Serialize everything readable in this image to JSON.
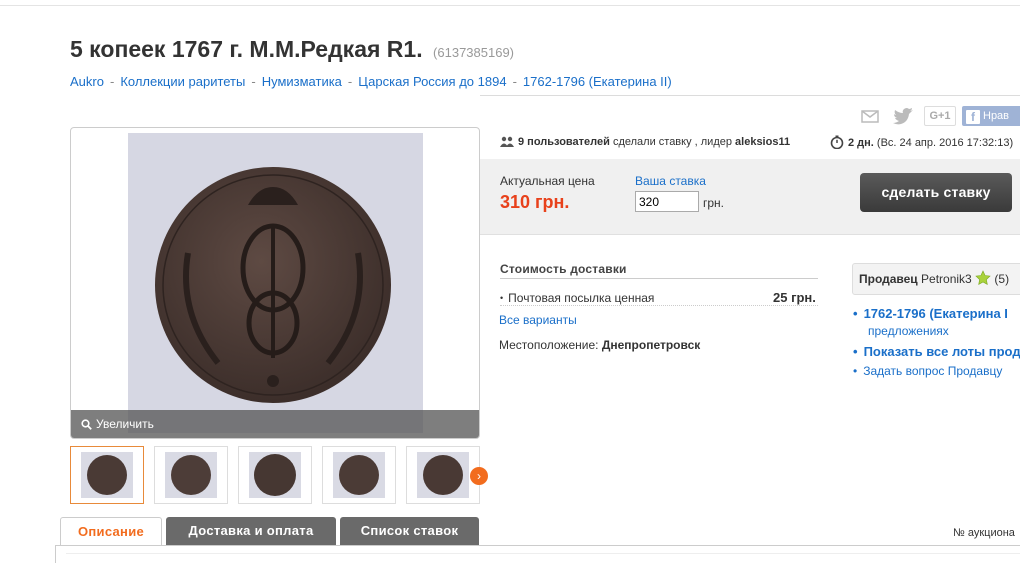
{
  "title": "5 копеек 1767 г. М.М.Редкая R1.",
  "lot_id": "(6137385169)",
  "breadcrumb": [
    "Aukro",
    "Коллекции раритеты",
    "Нумизматика",
    "Царская Россия до 1894",
    "1762-1796 (Екатерина II)"
  ],
  "breadcrumb_sep": "-",
  "gallery": {
    "zoom_label": "Увеличить",
    "next": "›"
  },
  "social": {
    "gplus": "G+1",
    "fb_letter": "f",
    "fb_label": "Нрав"
  },
  "bids": {
    "count": "9 пользователей",
    "text": " сделали ставку , лидер ",
    "leader": "aleksios11"
  },
  "timer": {
    "left": "2 дн.",
    "date": " (Вс. 24 апр. 2016 17:32:13)"
  },
  "price": {
    "current_label": "Актуальная цена",
    "current_value": "310 грн.",
    "your_label": "Ваша ставка",
    "your_value": "320",
    "unit": "грн.",
    "button": "сделать ставку"
  },
  "delivery": {
    "title": "Стоимость доставки",
    "item": "Почтовая посылка ценная",
    "item_price": "25 грн.",
    "all_variants": "Все варианты",
    "location_label": "Местоположение:",
    "location": "Днепропетровск"
  },
  "seller": {
    "label": "Продавец",
    "name": "Petronik3",
    "rating": "(5)",
    "links": [
      "1762-1796 (Екатерина I",
      "предложениях",
      "Показать все лоты прод",
      "Задать вопрос Продавцу"
    ]
  },
  "tabs": [
    "Описание",
    "Доставка и оплата",
    "Список ставок"
  ],
  "auction_no": "№ аукциона",
  "colors": {
    "accent": "#f26c1e",
    "link": "#1a6fc9",
    "price": "#e8411b"
  }
}
